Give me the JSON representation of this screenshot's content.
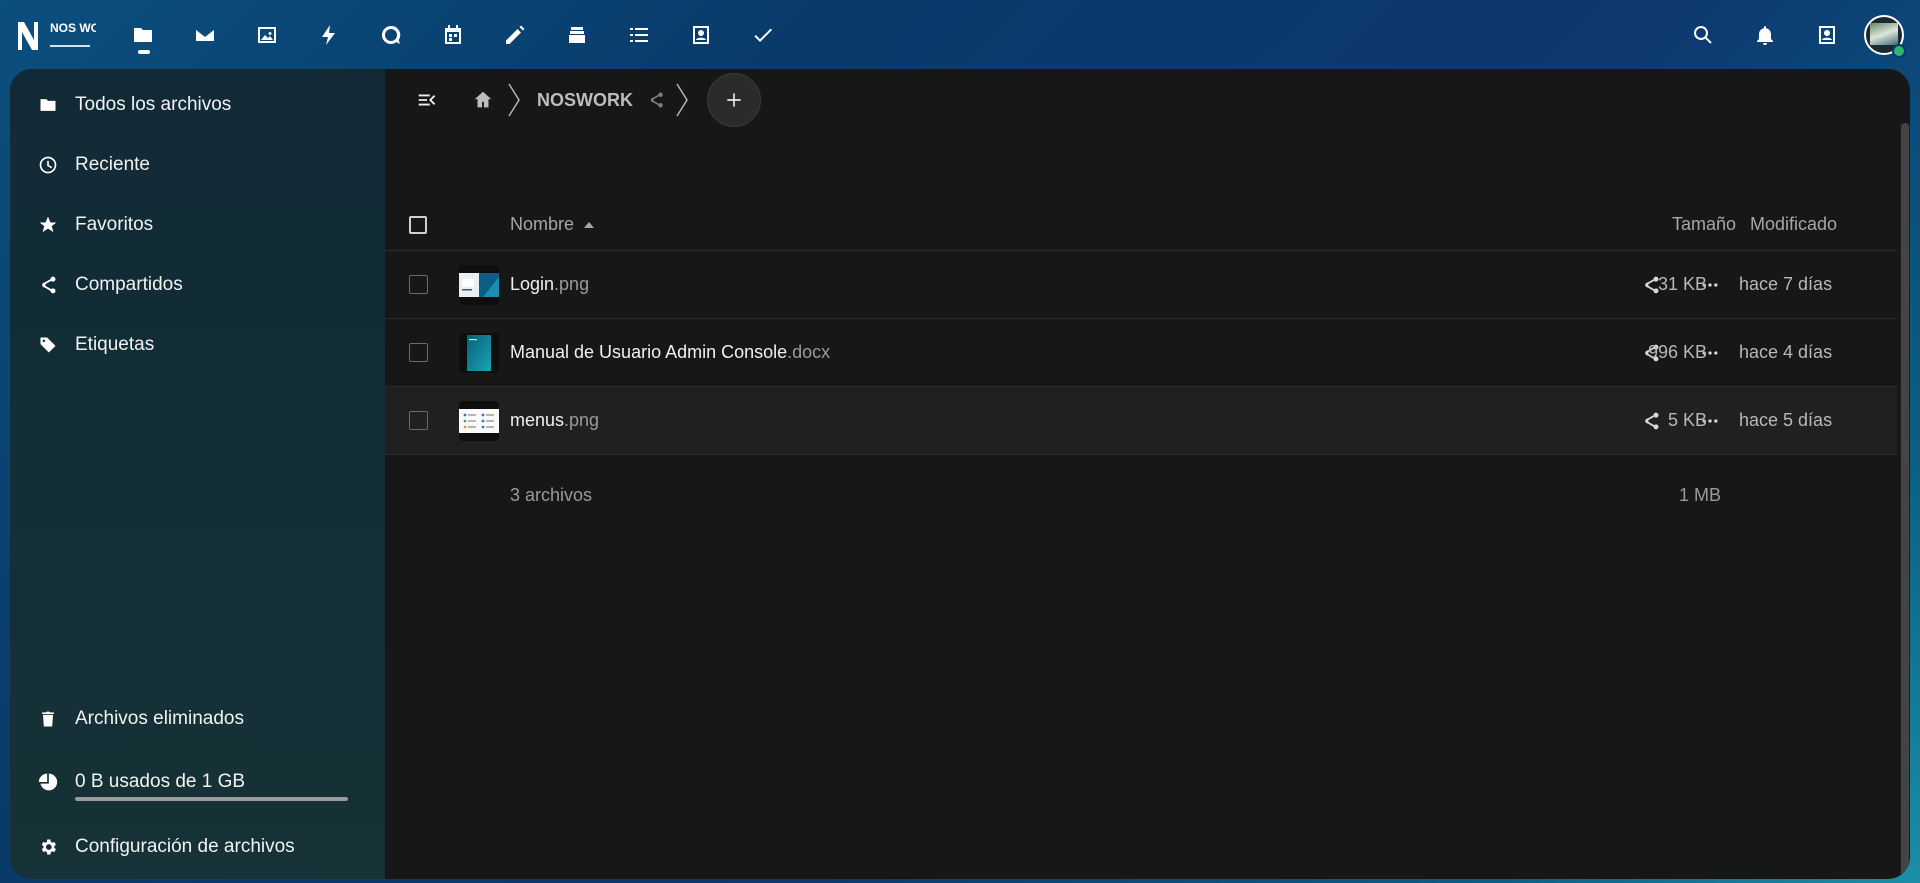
{
  "topbar": {
    "logo_text": "NOS WORK",
    "apps": [
      {
        "name": "files-icon",
        "active": true
      },
      {
        "name": "mail-icon"
      },
      {
        "name": "photos-icon"
      },
      {
        "name": "activity-icon"
      },
      {
        "name": "talk-icon"
      },
      {
        "name": "calendar-icon"
      },
      {
        "name": "notes-icon"
      },
      {
        "name": "deck-icon"
      },
      {
        "name": "tasks-icon"
      },
      {
        "name": "contacts-icon"
      },
      {
        "name": "check-icon"
      }
    ],
    "right": [
      "search-icon",
      "notifications-icon",
      "contacts-menu-icon"
    ]
  },
  "sidebar": {
    "items": [
      {
        "label": "Todos los archivos",
        "icon": "folder-icon"
      },
      {
        "label": "Reciente",
        "icon": "clock-icon"
      },
      {
        "label": "Favoritos",
        "icon": "star-icon"
      },
      {
        "label": "Compartidos",
        "icon": "share-icon"
      },
      {
        "label": "Etiquetas",
        "icon": "tag-icon"
      }
    ],
    "trash_label": "Archivos eliminados",
    "quota_label": "0 B usados de 1 GB",
    "quota_fraction": 0.0,
    "settings_label": "Configuración de archivos"
  },
  "breadcrumb": {
    "folder": "NOSWORK"
  },
  "table": {
    "headers": {
      "name": "Nombre",
      "size": "Tamaño",
      "modified": "Modificado"
    },
    "rows": [
      {
        "base": "Login",
        "ext": ".png",
        "size": "31 KB",
        "modified": "hace 7 días",
        "thumb": "login"
      },
      {
        "base": "Manual de Usuario Admin Console",
        "ext": ".docx",
        "size": "996 KB",
        "modified": "hace 4 días",
        "thumb": "doc"
      },
      {
        "base": "menus",
        "ext": ".png",
        "size": "5 KB",
        "modified": "hace 5 días",
        "thumb": "menus"
      }
    ],
    "footer": {
      "count": "3 archivos",
      "total": "1 MB"
    }
  },
  "colors": {
    "accent_green": "#2fb574",
    "background_dark": "#171717"
  }
}
